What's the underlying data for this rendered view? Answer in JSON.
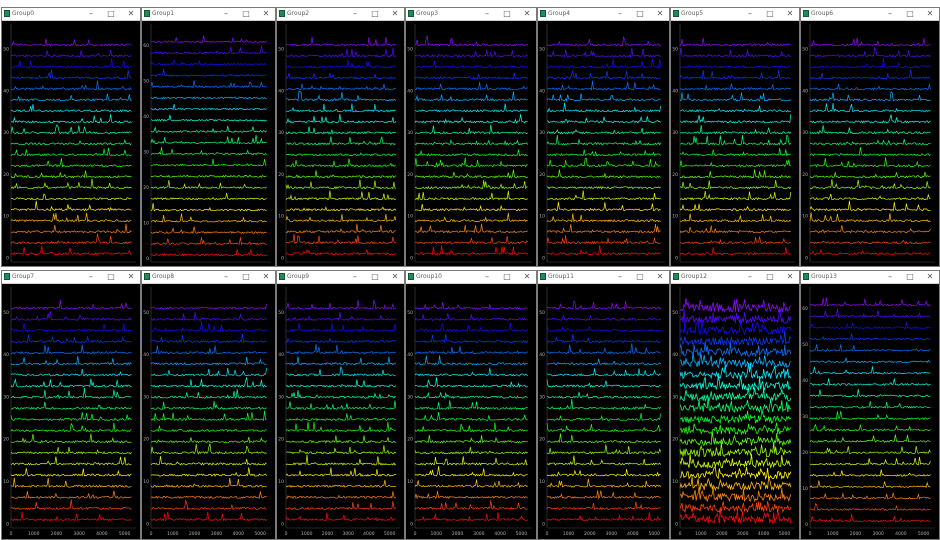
{
  "windows": [
    {
      "title": "Group0",
      "ytick_labels": [
        "0",
        "10",
        "20",
        "30",
        "40",
        "50"
      ],
      "xtick_labels": []
    },
    {
      "title": "Group1",
      "ytick_labels": [
        "0",
        "10",
        "20",
        "30",
        "40",
        "50",
        "60"
      ],
      "xtick_labels": []
    },
    {
      "title": "Group2",
      "ytick_labels": [
        "0",
        "10",
        "20",
        "30",
        "40",
        "50"
      ],
      "xtick_labels": []
    },
    {
      "title": "Group3",
      "ytick_labels": [
        "0",
        "10",
        "20",
        "30",
        "40",
        "50"
      ],
      "xtick_labels": []
    },
    {
      "title": "Group4",
      "ytick_labels": [
        "0",
        "10",
        "20",
        "30",
        "40",
        "50"
      ],
      "xtick_labels": []
    },
    {
      "title": "Group5",
      "ytick_labels": [
        "0",
        "10",
        "20",
        "30",
        "40",
        "50"
      ],
      "xtick_labels": []
    },
    {
      "title": "Group6",
      "ytick_labels": [
        "0",
        "10",
        "20",
        "30",
        "40",
        "50"
      ],
      "xtick_labels": []
    },
    {
      "title": "Group7",
      "ytick_labels": [
        "0",
        "10",
        "20",
        "30",
        "40",
        "50"
      ],
      "xtick_labels": [
        "0",
        "1000",
        "2000",
        "3000",
        "4000",
        "5000"
      ]
    },
    {
      "title": "Group8",
      "ytick_labels": [
        "0",
        "10",
        "20",
        "30",
        "40",
        "50"
      ],
      "xtick_labels": [
        "0",
        "1000",
        "2000",
        "3000",
        "4000",
        "5000"
      ]
    },
    {
      "title": "Group9",
      "ytick_labels": [
        "0",
        "10",
        "20",
        "30",
        "40",
        "50"
      ],
      "xtick_labels": [
        "0",
        "1000",
        "2000",
        "3000",
        "4000",
        "5000"
      ]
    },
    {
      "title": "Group10",
      "ytick_labels": [
        "0",
        "10",
        "20",
        "30",
        "40",
        "50"
      ],
      "xtick_labels": [
        "0",
        "1000",
        "2000",
        "3000",
        "4000",
        "5000"
      ]
    },
    {
      "title": "Group11",
      "ytick_labels": [
        "0",
        "10",
        "20",
        "30",
        "40",
        "50"
      ],
      "xtick_labels": [
        "0",
        "1000",
        "2000",
        "3000",
        "4000",
        "5000"
      ]
    },
    {
      "title": "Group12",
      "ytick_labels": [
        "0",
        "10",
        "20",
        "30",
        "40",
        "50"
      ],
      "xtick_labels": [
        "0",
        "1000",
        "2000",
        "3000",
        "4000",
        "5000"
      ]
    },
    {
      "title": "Group13",
      "ytick_labels": [
        "0",
        "10",
        "20",
        "30",
        "40",
        "50",
        "60"
      ],
      "xtick_labels": [
        "0",
        "1000",
        "2000",
        "3000",
        "4000",
        "5000"
      ]
    }
  ],
  "window_controls": {
    "minimize": "–",
    "maximize": "□",
    "close": "✕"
  },
  "chart_defaults": {
    "type": "line",
    "traces_per_window": 20,
    "x_range": [
      0,
      5500
    ],
    "background": "#000000",
    "trace_colormap": "red (bottom) → orange → yellow → green → cyan → blue → violet (top)"
  }
}
